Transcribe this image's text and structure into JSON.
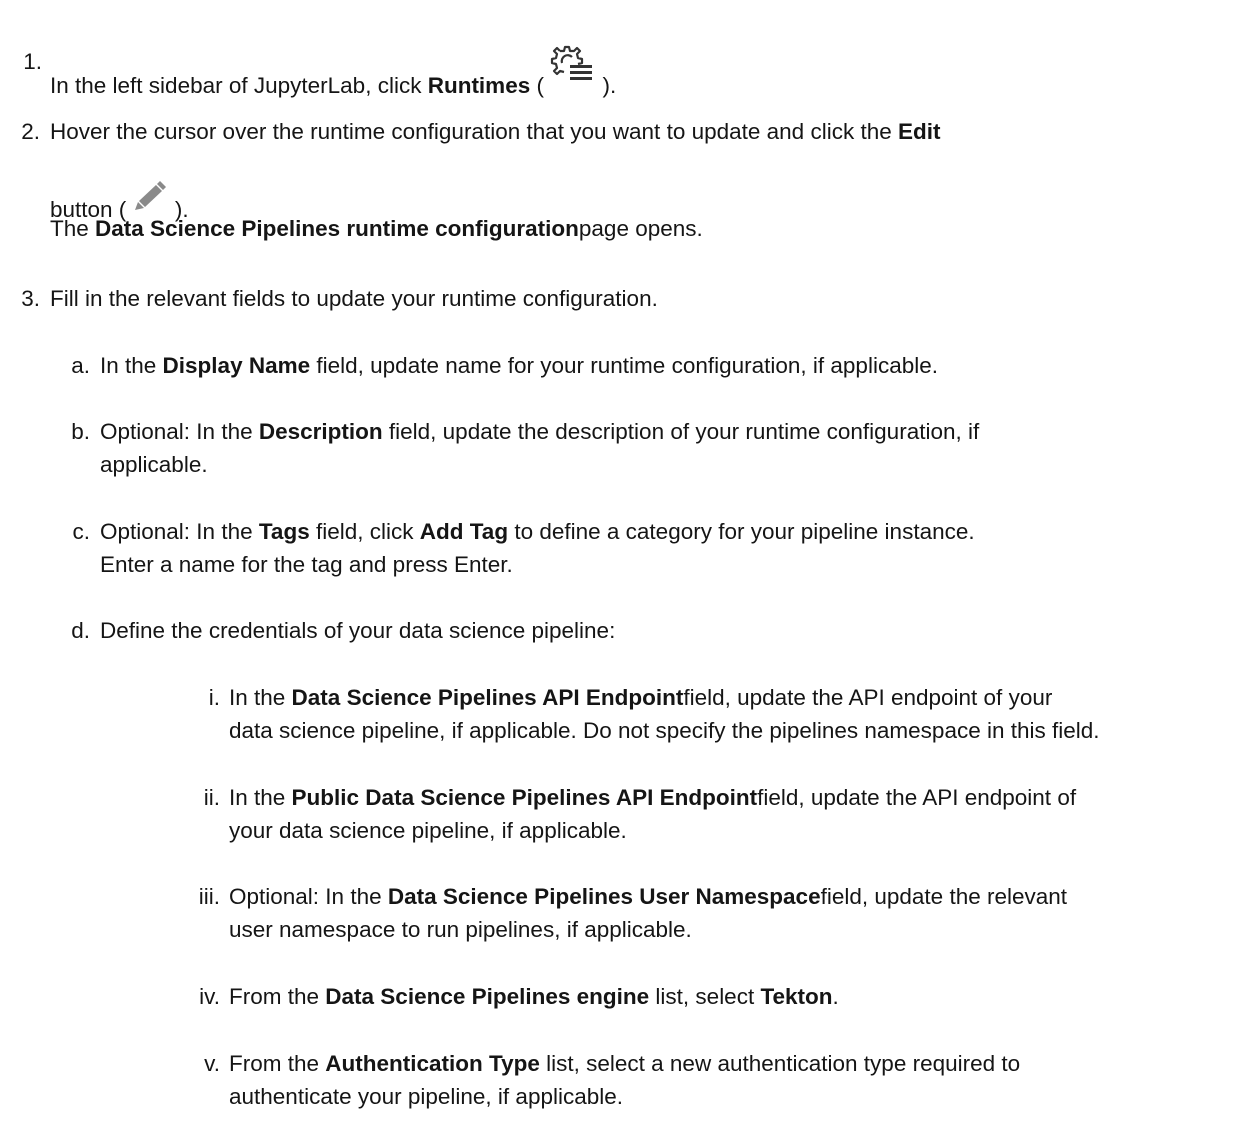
{
  "steps": [
    {
      "num": "1.",
      "pre": "In the left sidebar of JupyterLab, click ",
      "b1": "Runtimes",
      "mid": " ( ",
      "icon": "runtimes-gear-list-icon",
      "post": " )."
    },
    {
      "num": "2.",
      "line1_pre": "Hover the cursor over the runtime configuration that you want to update and click the ",
      "line1_b": "Edit",
      "line2_pre": "button ( ",
      "icon": "pencil-edit-icon",
      "line2_post": " ).",
      "line3_pre": "The ",
      "line3_b": "Data Science Pipelines runtime configuration",
      "line3_post": "page opens."
    },
    {
      "num": "3.",
      "text": "Fill in the relevant fields to update your runtime configuration."
    }
  ],
  "substeps": [
    {
      "num": "a.",
      "pre": "In the ",
      "b": "Display Name",
      "post": " field, update name for your runtime configuration, if applicable."
    },
    {
      "num": "b.",
      "pre": "Optional: In the ",
      "b": "Description",
      "post": " field, update the description of your runtime configuration, if",
      "line2": "applicable."
    },
    {
      "num": "c.",
      "pre": "Optional: In the ",
      "b": "Tags",
      "mid": " field, click ",
      "b2": "Add Tag",
      "post": " to define a category for your pipeline instance.",
      "line2": "Enter a name for the tag and press Enter."
    },
    {
      "num": "d.",
      "text": "Define the credentials of your data science pipeline:"
    }
  ],
  "subsubsteps": [
    {
      "num": "i.",
      "pre": "In the ",
      "b": "Data Science Pipelines API Endpoint",
      "post": "field, update the API endpoint of your",
      "line2": "data science pipeline, if applicable. Do not specify the pipelines namespace in this field."
    },
    {
      "num": "ii.",
      "pre": "In the ",
      "b": "Public Data Science Pipelines API Endpoint",
      "post": "field, update the API endpoint of",
      "line2": "your data science pipeline, if applicable."
    },
    {
      "num": "iii.",
      "pre": "Optional: In the ",
      "b": "Data Science Pipelines User Namespace",
      "post": "field, update the relevant",
      "line2": "user namespace to run pipelines, if applicable."
    },
    {
      "num": "iv.",
      "pre": "From the ",
      "b": "Data Science Pipelines engine",
      "mid": " list, select ",
      "b2": "Tekton",
      "post": "."
    },
    {
      "num": "v.",
      "pre": "From the ",
      "b": "Authentication Type",
      "post": " list, select a new authentication type required to",
      "line2": "authenticate your pipeline, if applicable."
    }
  ]
}
